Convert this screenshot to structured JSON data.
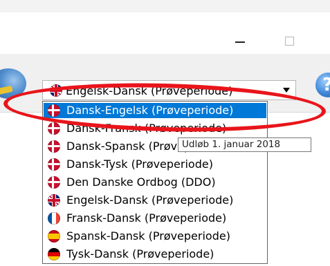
{
  "window": {
    "minimize_glyph": "–",
    "maximize_glyph": "☐"
  },
  "toolbar": {
    "left_icon": "dictionary-app-icon",
    "right_icon": "help-icon",
    "help_glyph": "?"
  },
  "dictionary_select": {
    "selected_value": "Engelsk-Dansk (Prøveperiode)",
    "selected_icon": "flag-uk-icon",
    "options": [
      {
        "label": "Dansk-Engelsk (Prøveperiode)",
        "icon": "flag-dk-icon",
        "highlighted": true
      },
      {
        "label": "Dansk-Fransk (Prøveperiode)",
        "icon": "flag-dk-icon"
      },
      {
        "label": "Dansk-Spansk (Prøveperiode)",
        "icon": "flag-dk-icon"
      },
      {
        "label": "Dansk-Tysk (Prøveperiode)",
        "icon": "flag-dk-icon"
      },
      {
        "label": "Den Danske Ordbog (DDO)",
        "icon": "flag-dk-icon"
      },
      {
        "label": "Engelsk-Dansk (Prøveperiode)",
        "icon": "flag-uk-icon"
      },
      {
        "label": "Fransk-Dansk (Prøveperiode)",
        "icon": "flag-fr-icon"
      },
      {
        "label": "Spansk-Dansk (Prøveperiode)",
        "icon": "flag-es-icon"
      },
      {
        "label": "Tysk-Dansk (Prøveperiode)",
        "icon": "flag-de-icon"
      }
    ]
  },
  "tooltip": {
    "text": "Udløb 1. januar 2018"
  },
  "colors": {
    "highlight": "#0078d7",
    "annotation_ellipse": "#e8151b"
  }
}
